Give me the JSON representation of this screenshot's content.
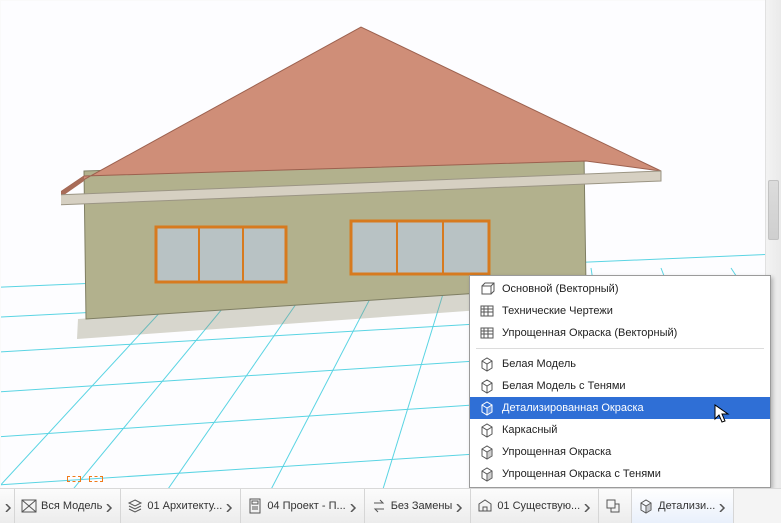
{
  "popup": {
    "group1": [
      {
        "label": "Основной (Векторный)",
        "icon": "layered-cube"
      },
      {
        "label": "Технические Чертежи",
        "icon": "layered-hatch"
      },
      {
        "label": "Упрощенная Окраска (Векторный)",
        "icon": "layered-hatch"
      }
    ],
    "group2": [
      {
        "label": "Белая Модель",
        "icon": "cube-outline"
      },
      {
        "label": "Белая Модель с Тенями",
        "icon": "cube-outline"
      },
      {
        "label": "Детализированная Окраска",
        "icon": "cube-shaded",
        "selected": true
      },
      {
        "label": "Каркасный",
        "icon": "cube-outline"
      },
      {
        "label": "Упрощенная Окраска",
        "icon": "cube-shaded"
      },
      {
        "label": "Упрощенная Окраска с Тенями",
        "icon": "cube-shaded"
      }
    ]
  },
  "bar": {
    "items": [
      {
        "icon": "zoom-set",
        "label": "Вся Модель"
      },
      {
        "icon": "layer-filter",
        "label": "01 Архитекту..."
      },
      {
        "icon": "page",
        "label": "04 Проект - П..."
      },
      {
        "icon": "swap",
        "label": "Без Замены"
      },
      {
        "icon": "reno",
        "label": "01 Существую..."
      },
      {
        "icon": "style-cube",
        "label": "Детализи...",
        "active": true
      }
    ]
  }
}
